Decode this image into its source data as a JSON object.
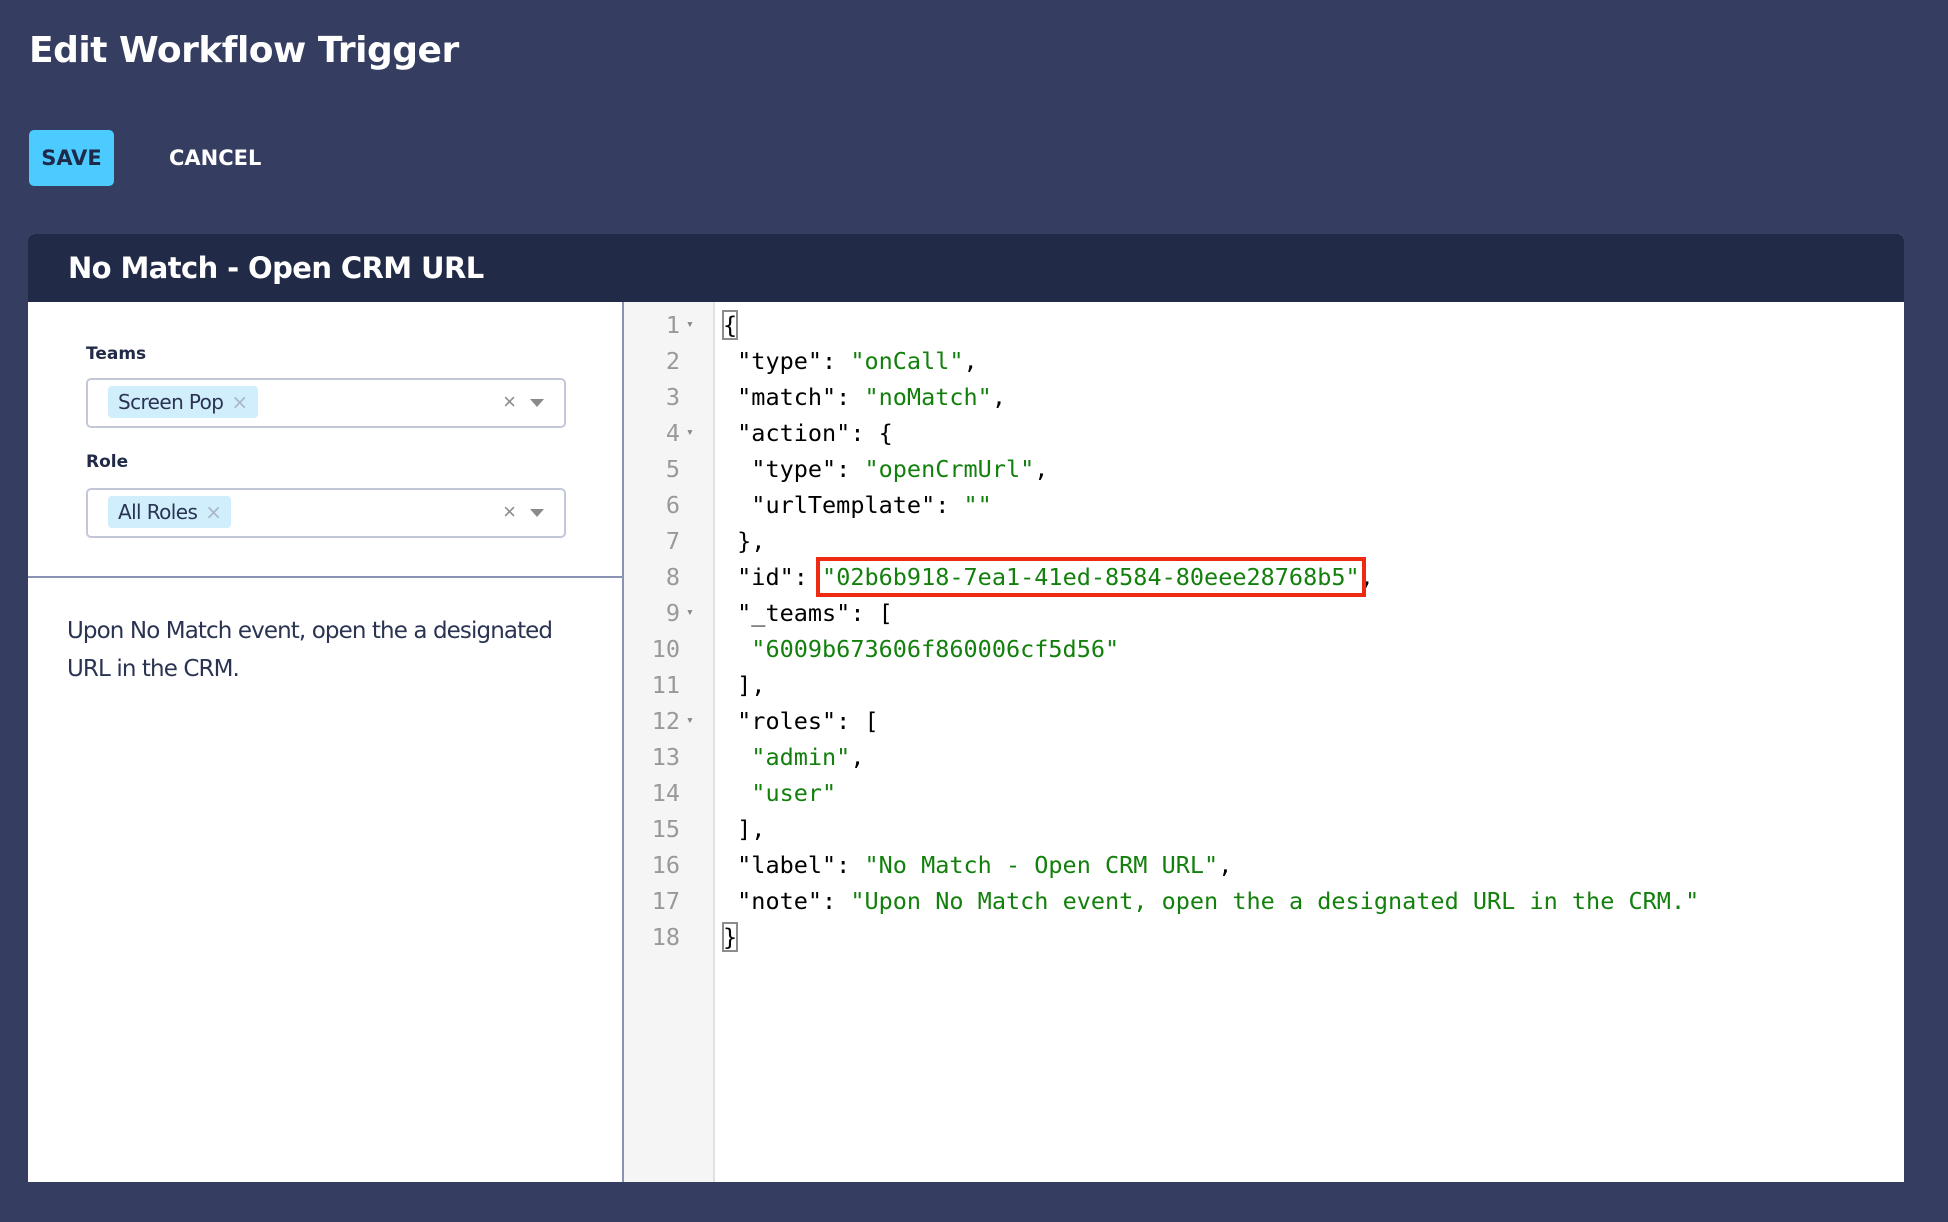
{
  "page": {
    "title": "Edit Workflow Trigger"
  },
  "toolbar": {
    "save_label": "SAVE",
    "cancel_label": "CANCEL"
  },
  "card": {
    "title": "No Match - Open CRM URL",
    "teams": {
      "label": "Teams",
      "selected": [
        "Screen Pop"
      ]
    },
    "role": {
      "label": "Role",
      "selected": [
        "All Roles"
      ]
    },
    "description": "Upon No Match event, open the a designated URL in the CRM."
  },
  "editor": {
    "lines": [
      {
        "n": "1",
        "fold": true,
        "parts": [
          {
            "t": "{",
            "c": "bracket"
          }
        ]
      },
      {
        "n": "2",
        "fold": false,
        "parts": [
          {
            "t": " \"type\": "
          },
          {
            "t": "\"onCall\"",
            "c": "str"
          },
          {
            "t": ","
          }
        ]
      },
      {
        "n": "3",
        "fold": false,
        "parts": [
          {
            "t": " \"match\": "
          },
          {
            "t": "\"noMatch\"",
            "c": "str"
          },
          {
            "t": ","
          }
        ]
      },
      {
        "n": "4",
        "fold": true,
        "parts": [
          {
            "t": " \"action\": {"
          }
        ]
      },
      {
        "n": "5",
        "fold": false,
        "parts": [
          {
            "t": "  \"type\": "
          },
          {
            "t": "\"openCrmUrl\"",
            "c": "str"
          },
          {
            "t": ","
          }
        ]
      },
      {
        "n": "6",
        "fold": false,
        "parts": [
          {
            "t": "  \"urlTemplate\": "
          },
          {
            "t": "\"\"",
            "c": "str"
          }
        ]
      },
      {
        "n": "7",
        "fold": false,
        "parts": [
          {
            "t": " },"
          }
        ]
      },
      {
        "n": "8",
        "fold": false,
        "parts": [
          {
            "t": " \"id\": "
          },
          {
            "t": "\"02b6b918-7ea1-41ed-8584-80eee28768b5\"",
            "c": "str highlight"
          },
          {
            "t": ","
          }
        ]
      },
      {
        "n": "9",
        "fold": true,
        "parts": [
          {
            "t": " \"_teams\": ["
          }
        ]
      },
      {
        "n": "10",
        "fold": false,
        "parts": [
          {
            "t": "  "
          },
          {
            "t": "\"6009b673606f860006cf5d56\"",
            "c": "str"
          }
        ]
      },
      {
        "n": "11",
        "fold": false,
        "parts": [
          {
            "t": " ],"
          }
        ]
      },
      {
        "n": "12",
        "fold": true,
        "parts": [
          {
            "t": " \"roles\": ["
          }
        ]
      },
      {
        "n": "13",
        "fold": false,
        "parts": [
          {
            "t": "  "
          },
          {
            "t": "\"admin\"",
            "c": "str"
          },
          {
            "t": ","
          }
        ]
      },
      {
        "n": "14",
        "fold": false,
        "parts": [
          {
            "t": "  "
          },
          {
            "t": "\"user\"",
            "c": "str"
          }
        ]
      },
      {
        "n": "15",
        "fold": false,
        "parts": [
          {
            "t": " ],"
          }
        ]
      },
      {
        "n": "16",
        "fold": false,
        "parts": [
          {
            "t": " \"label\": "
          },
          {
            "t": "\"No Match - Open CRM URL\"",
            "c": "str"
          },
          {
            "t": ","
          }
        ]
      },
      {
        "n": "17",
        "fold": false,
        "parts": [
          {
            "t": " \"note\": "
          },
          {
            "t": "\"Upon No Match event, open the a designated URL in the CRM.\"",
            "c": "str"
          }
        ]
      },
      {
        "n": "18",
        "fold": false,
        "parts": [
          {
            "t": "}",
            "c": "bracket"
          }
        ]
      }
    ],
    "fold_icon": "▾"
  },
  "icons": {
    "chip_remove": "×",
    "clear": "×"
  },
  "colors": {
    "background": "#353e60",
    "header": "#212a47",
    "save_button": "#4bcbff",
    "string": "#13800d",
    "highlight": "#ee2a12",
    "chip": "#d1eefd"
  }
}
